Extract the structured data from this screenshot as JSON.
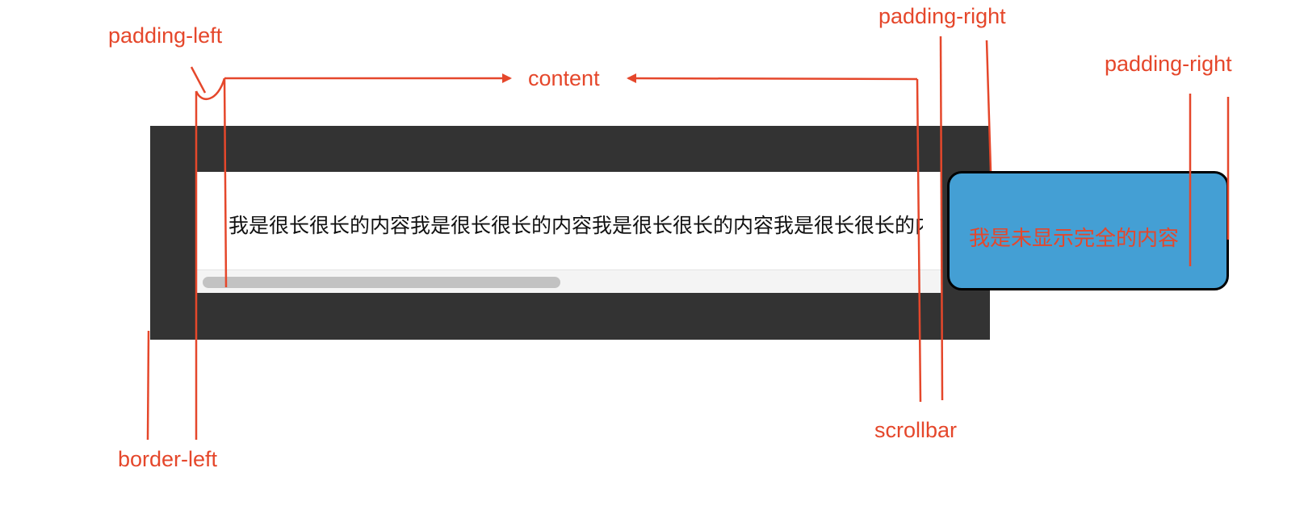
{
  "labels": {
    "padding_left": "padding-left",
    "content": "content",
    "padding_right_top": "padding-right",
    "padding_right_side": "padding-right",
    "scrollbar": "scrollbar",
    "border_left": "border-left"
  },
  "box": {
    "text": "我是很长很长的内容我是很长很长的内容我是很长很长的内容我是很长很长的内容"
  },
  "overflow": {
    "text": "我是未显示完全的内容"
  },
  "colors": {
    "annotation": "#e5472b",
    "border": "#333333",
    "overflow_fill": "#449fd4",
    "scroll_thumb": "#c2c2c2"
  }
}
